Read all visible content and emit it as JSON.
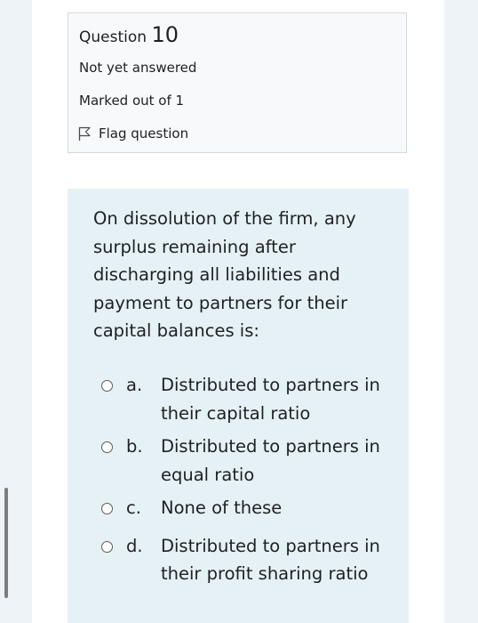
{
  "question_info": {
    "label": "Question",
    "number": "10",
    "state": "Not yet answered",
    "grade": "Marked out of 1",
    "flag_label": "Flag question",
    "flag_icon": "flag-outline-icon"
  },
  "question": {
    "text": "On dissolution of the firm, any surplus remaining after discharging all liabilities and payment to partners for their capital balances is:",
    "options": [
      {
        "letter": "a.",
        "text": "Distributed to partners in their capital ratio",
        "selected": false
      },
      {
        "letter": "b.",
        "text": "Distributed to partners in equal ratio",
        "selected": false
      },
      {
        "letter": "c.",
        "text": "None of these",
        "selected": false
      },
      {
        "letter": "d.",
        "text": "Distributed to partners in their profit sharing ratio",
        "selected": false
      }
    ]
  },
  "colors": {
    "page_background": "#eef3f7",
    "card_background": "#ffffff",
    "info_background": "#f8f9fa",
    "info_border": "#d6d9dc",
    "content_background": "#e6f1f5",
    "text": "#1d2125"
  }
}
